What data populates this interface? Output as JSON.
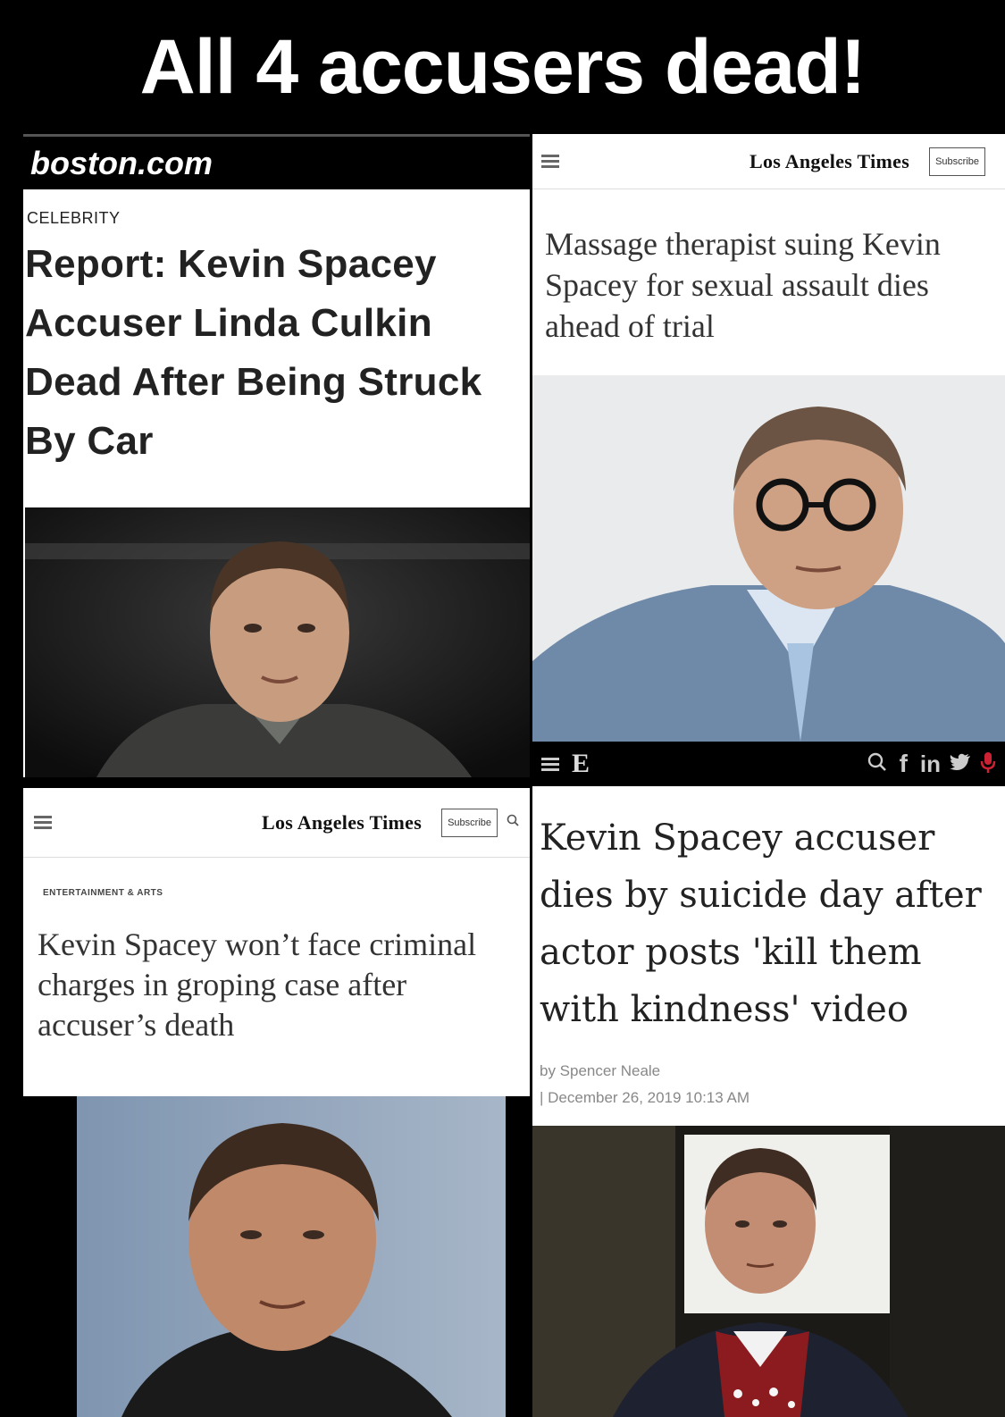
{
  "meme_title": "All 4 accusers dead!",
  "panel1": {
    "site_logo": "boston.com",
    "kicker": "CELEBRITY",
    "headline": "Report: Kevin Spacey Accuser Linda Culkin Dead After Being Struck By Car"
  },
  "panel2": {
    "masthead": "Los Angeles Times",
    "subscribe": "Subscribe",
    "headline": "Massage therapist suing Kevin Spacey for sexual assault dies ahead of trial"
  },
  "panel3": {
    "masthead": "Los Angeles Times",
    "subscribe": "Subscribe",
    "kicker": "ENTERTAINMENT & ARTS",
    "headline": "Kevin Spacey won’t face criminal charges in groping case after accuser’s death"
  },
  "panel4": {
    "nav_logo": "E",
    "headline": "Kevin Spacey accuser dies by suicide day after actor posts 'kill them with kindness' video",
    "byline": "by Spencer Neale",
    "date": "| December 26, 2019 10:13 AM",
    "social": {
      "f": "f",
      "in": "in"
    }
  },
  "colors": {
    "background": "#000000",
    "card": "#ffffff",
    "headline_text": "#222222"
  },
  "icons": [
    "menu-icon",
    "search-icon",
    "facebook-icon",
    "linkedin-icon",
    "twitter-icon",
    "podcast-icon"
  ]
}
